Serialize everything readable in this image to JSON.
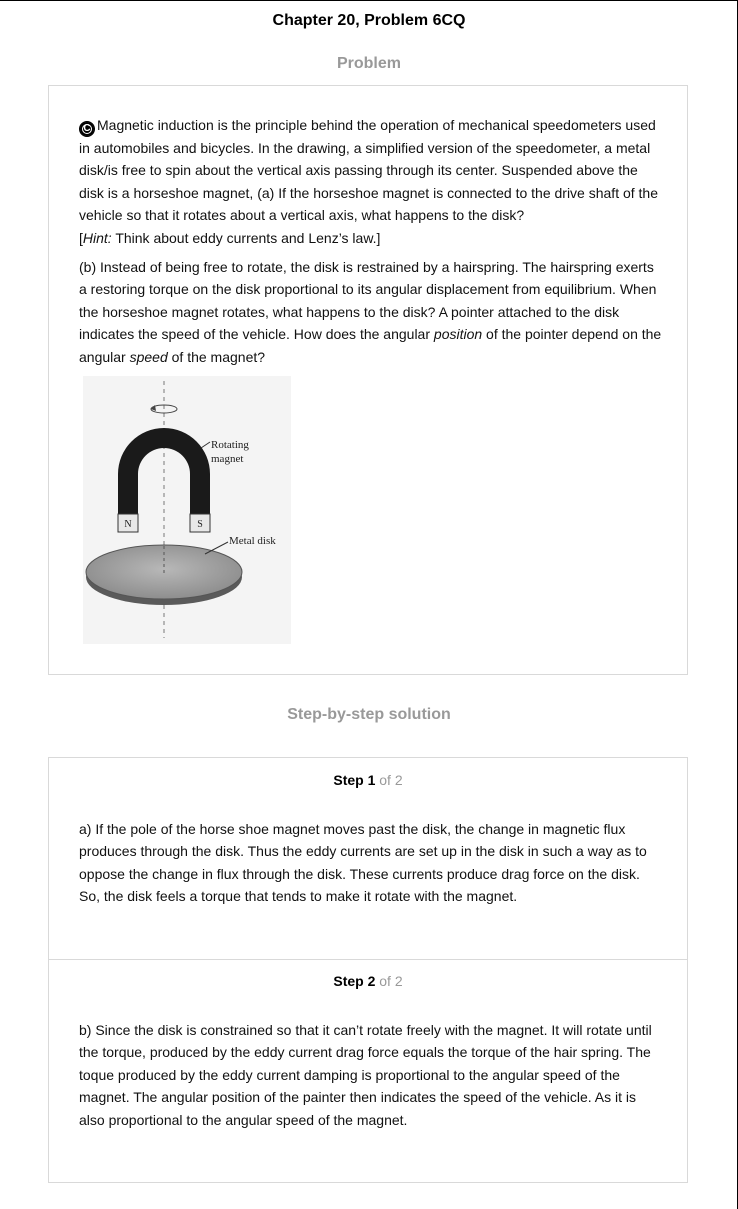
{
  "header": {
    "title": "Chapter 20, Problem 6CQ"
  },
  "problem": {
    "heading": "Problem",
    "badge": "C",
    "para1": "Magnetic induction is the principle behind the operation of mechanical speedometers used in automobiles and bicycles. In the drawing, a simplified version of the speedometer, a metal disk/is free to spin about the vertical axis passing through its center. Suspended above the disk is a horseshoe magnet, (a) If the horseshoe magnet is connected to the drive shaft of the vehicle so that it rotates about a vertical axis, what happens to the disk?",
    "hint_open": "[",
    "hint_label": "Hint:",
    "hint_text": " Think about eddy currents and Lenz’s law.]",
    "para2_a": "(b) Instead of being free to rotate, the disk is restrained by a hairspring. The hairspring exerts a restoring torque on the disk proportional to its angular displacement from equilibrium. When the horseshoe magnet rotates, what happens to the disk? A pointer attached to the disk indicates the speed of the vehicle. How does the angular ",
    "para2_em1": "position",
    "para2_b": " of the pointer depend on the angular ",
    "para2_em2": "speed",
    "para2_c": " of the magnet?",
    "figure": {
      "label_rotating": "Rotating",
      "label_magnet": "magnet",
      "label_disk": "Metal disk",
      "pole_n": "N",
      "pole_s": "S"
    }
  },
  "solution": {
    "heading": "Step-by-step solution",
    "steps": [
      {
        "label": "Step 1",
        "of": " of 2",
        "text": "a) If the pole of the horse shoe magnet moves past the disk, the change in magnetic flux produces through the disk. Thus the eddy currents are set up in the disk in such a way as to oppose the change in flux through the disk. These currents produce drag force on the disk. So, the disk feels a torque that tends to make it rotate with the magnet."
      },
      {
        "label": "Step 2",
        "of": " of 2",
        "text": "b) Since the disk is constrained so that it can’t rotate freely with the magnet. It will rotate until the torque, produced by the eddy current drag force equals the torque of the hair spring. The toque produced by the eddy current damping is proportional to the angular speed of the magnet. The angular position of the painter then indicates the speed of the vehicle. As it is also proportional to the angular speed of the magnet."
      }
    ]
  }
}
